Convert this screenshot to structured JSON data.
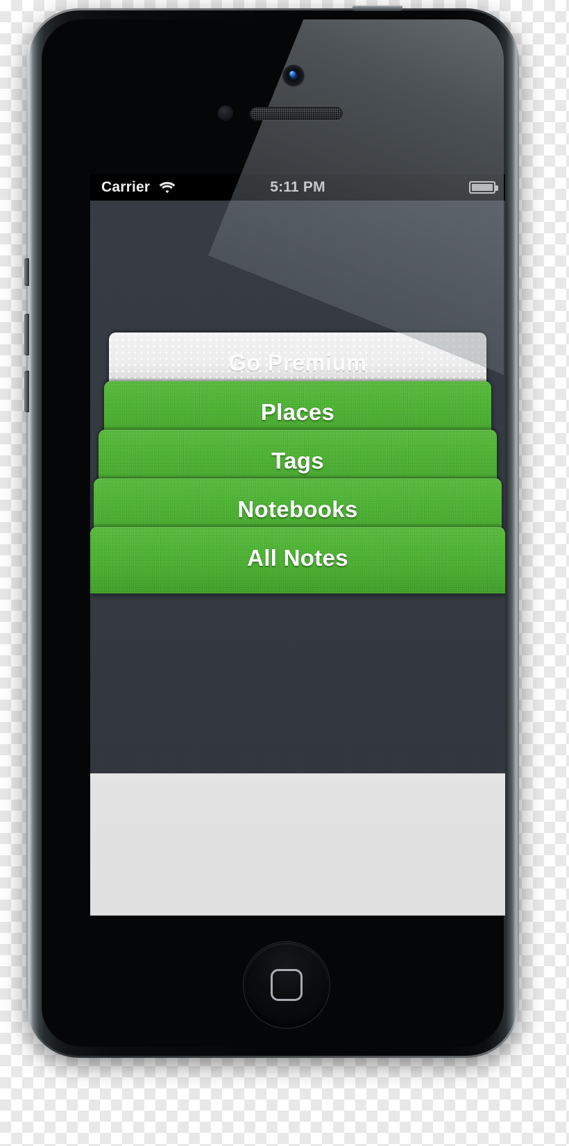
{
  "device": {
    "name": "iPhone 5 black",
    "hardware": {
      "camera": "front-camera",
      "proximity_sensor": "proximity-sensor",
      "earpiece": "earpiece-speaker",
      "home_button": "home-button",
      "silent_switch": "silent-switch",
      "volume_up": "volume-up-button",
      "volume_down": "volume-down-button",
      "power_button": "power-button"
    }
  },
  "status_bar": {
    "carrier": "Carrier",
    "wifi_icon": "wifi-icon",
    "time": "5:11 PM",
    "battery_icon": "battery-full-icon"
  },
  "app": {
    "background_color": "#353a42",
    "accent_green": "#4cb232",
    "premium_gray": "#ececec",
    "content_panel_color": "#e2e2e2",
    "tabs": [
      {
        "label": "Go Premium",
        "style": "premium",
        "color": "#ececec"
      },
      {
        "label": "Places",
        "style": "green",
        "color": "#4cb232"
      },
      {
        "label": "Tags",
        "style": "green",
        "color": "#4cb232"
      },
      {
        "label": "Notebooks",
        "style": "green",
        "color": "#4cb232"
      },
      {
        "label": "All Notes",
        "style": "green",
        "color": "#4cb232"
      }
    ]
  }
}
